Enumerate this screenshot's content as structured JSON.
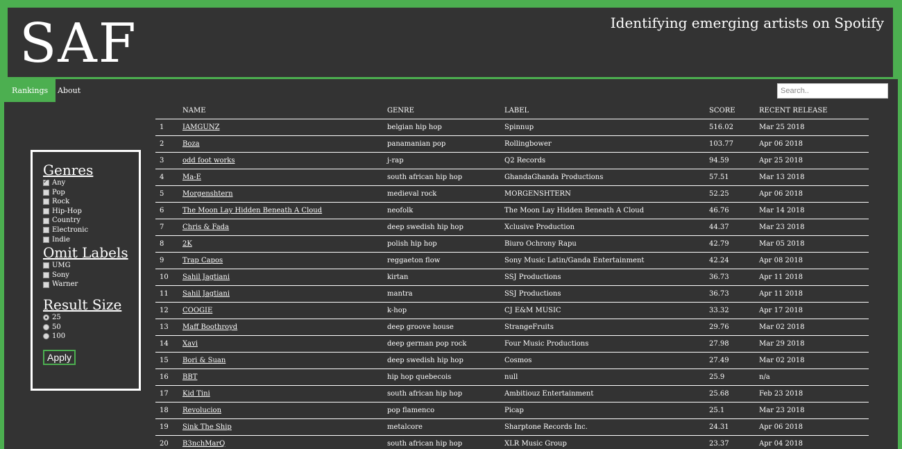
{
  "header": {
    "logo": "SAF",
    "tagline": "Identifying emerging artists on Spotify"
  },
  "nav": {
    "items": [
      {
        "label": "Rankings",
        "active": true
      },
      {
        "label": "About",
        "active": false
      }
    ],
    "search_placeholder": "Search.."
  },
  "filters": {
    "genres_title": "Genres",
    "genres": [
      {
        "label": "Any",
        "checked": true
      },
      {
        "label": "Pop",
        "checked": false
      },
      {
        "label": "Rock",
        "checked": false
      },
      {
        "label": "Hip-Hop",
        "checked": false
      },
      {
        "label": "Country",
        "checked": false
      },
      {
        "label": "Electronic",
        "checked": false
      },
      {
        "label": "Indie",
        "checked": false
      }
    ],
    "labels_title": "Omit Labels",
    "labels": [
      {
        "label": "UMG",
        "checked": false
      },
      {
        "label": "Sony",
        "checked": false
      },
      {
        "label": "Warner",
        "checked": false
      }
    ],
    "size_title": "Result Size",
    "sizes": [
      {
        "label": "25",
        "checked": true
      },
      {
        "label": "50",
        "checked": false
      },
      {
        "label": "100",
        "checked": false
      }
    ],
    "apply_label": "Apply"
  },
  "table": {
    "columns": [
      "",
      "NAME",
      "GENRE",
      "LABEL",
      "SCORE",
      "RECENT RELEASE"
    ],
    "rows": [
      [
        "1",
        "IAMGUNZ",
        "belgian hip hop",
        "Spinnup",
        "516.02",
        "Mar 25 2018"
      ],
      [
        "2",
        "Boza",
        "panamanian pop",
        "Rollingbower",
        "103.77",
        "Apr 06 2018"
      ],
      [
        "3",
        "odd foot works",
        "j-rap",
        "Q2 Records",
        "94.59",
        "Apr 25 2018"
      ],
      [
        "4",
        "Ma-E",
        "south african hip hop",
        "GhandaGhanda Productions",
        "57.51",
        "Mar 13 2018"
      ],
      [
        "5",
        "Morgenshtern",
        "medieval rock",
        "MORGENSHTERN",
        "52.25",
        "Apr 06 2018"
      ],
      [
        "6",
        "The Moon Lay Hidden Beneath A Cloud",
        "neofolk",
        "The Moon Lay Hidden Beneath A Cloud",
        "46.76",
        "Mar 14 2018"
      ],
      [
        "7",
        "Chris & Fada",
        "deep swedish hip hop",
        "Xclusive Production",
        "44.37",
        "Mar 23 2018"
      ],
      [
        "8",
        "2K",
        "polish hip hop",
        "Biuro Ochrony Rapu",
        "42.79",
        "Mar 05 2018"
      ],
      [
        "9",
        "Trap Capos",
        "reggaeton flow",
        "Sony Music Latin/Ganda Entertainment",
        "42.24",
        "Apr 08 2018"
      ],
      [
        "10",
        "Sahil Jagtiani",
        "kirtan",
        "SSJ Productions",
        "36.73",
        "Apr 11 2018"
      ],
      [
        "11",
        "Sahil Jagtiani",
        "mantra",
        "SSJ Productions",
        "36.73",
        "Apr 11 2018"
      ],
      [
        "12",
        "COOGIE",
        "k-hop",
        "CJ E&M MUSIC",
        "33.32",
        "Apr 17 2018"
      ],
      [
        "13",
        "Maff Boothroyd",
        "deep groove house",
        "StrangeFruits",
        "29.76",
        "Mar 02 2018"
      ],
      [
        "14",
        "Xavi",
        "deep german pop rock",
        "Four Music Productions",
        "27.98",
        "Mar 29 2018"
      ],
      [
        "15",
        "Bori & Suan",
        "deep swedish hip hop",
        "Cosmos",
        "27.49",
        "Mar 02 2018"
      ],
      [
        "16",
        "BBT",
        "hip hop quebecois",
        "null",
        "25.9",
        "n/a"
      ],
      [
        "17",
        "Kid Tini",
        "south african hip hop",
        "Ambitiouz Entertainment",
        "25.68",
        "Feb 23 2018"
      ],
      [
        "18",
        "Revolucion",
        "pop flamenco",
        "Picap",
        "25.1",
        "Mar 23 2018"
      ],
      [
        "19",
        "Sink The Ship",
        "metalcore",
        "Sharptone Records Inc.",
        "24.31",
        "Apr 06 2018"
      ],
      [
        "20",
        "B3nchMarQ",
        "south african hip hop",
        "XLR Music Group",
        "23.37",
        "Apr 04 2018"
      ]
    ]
  }
}
